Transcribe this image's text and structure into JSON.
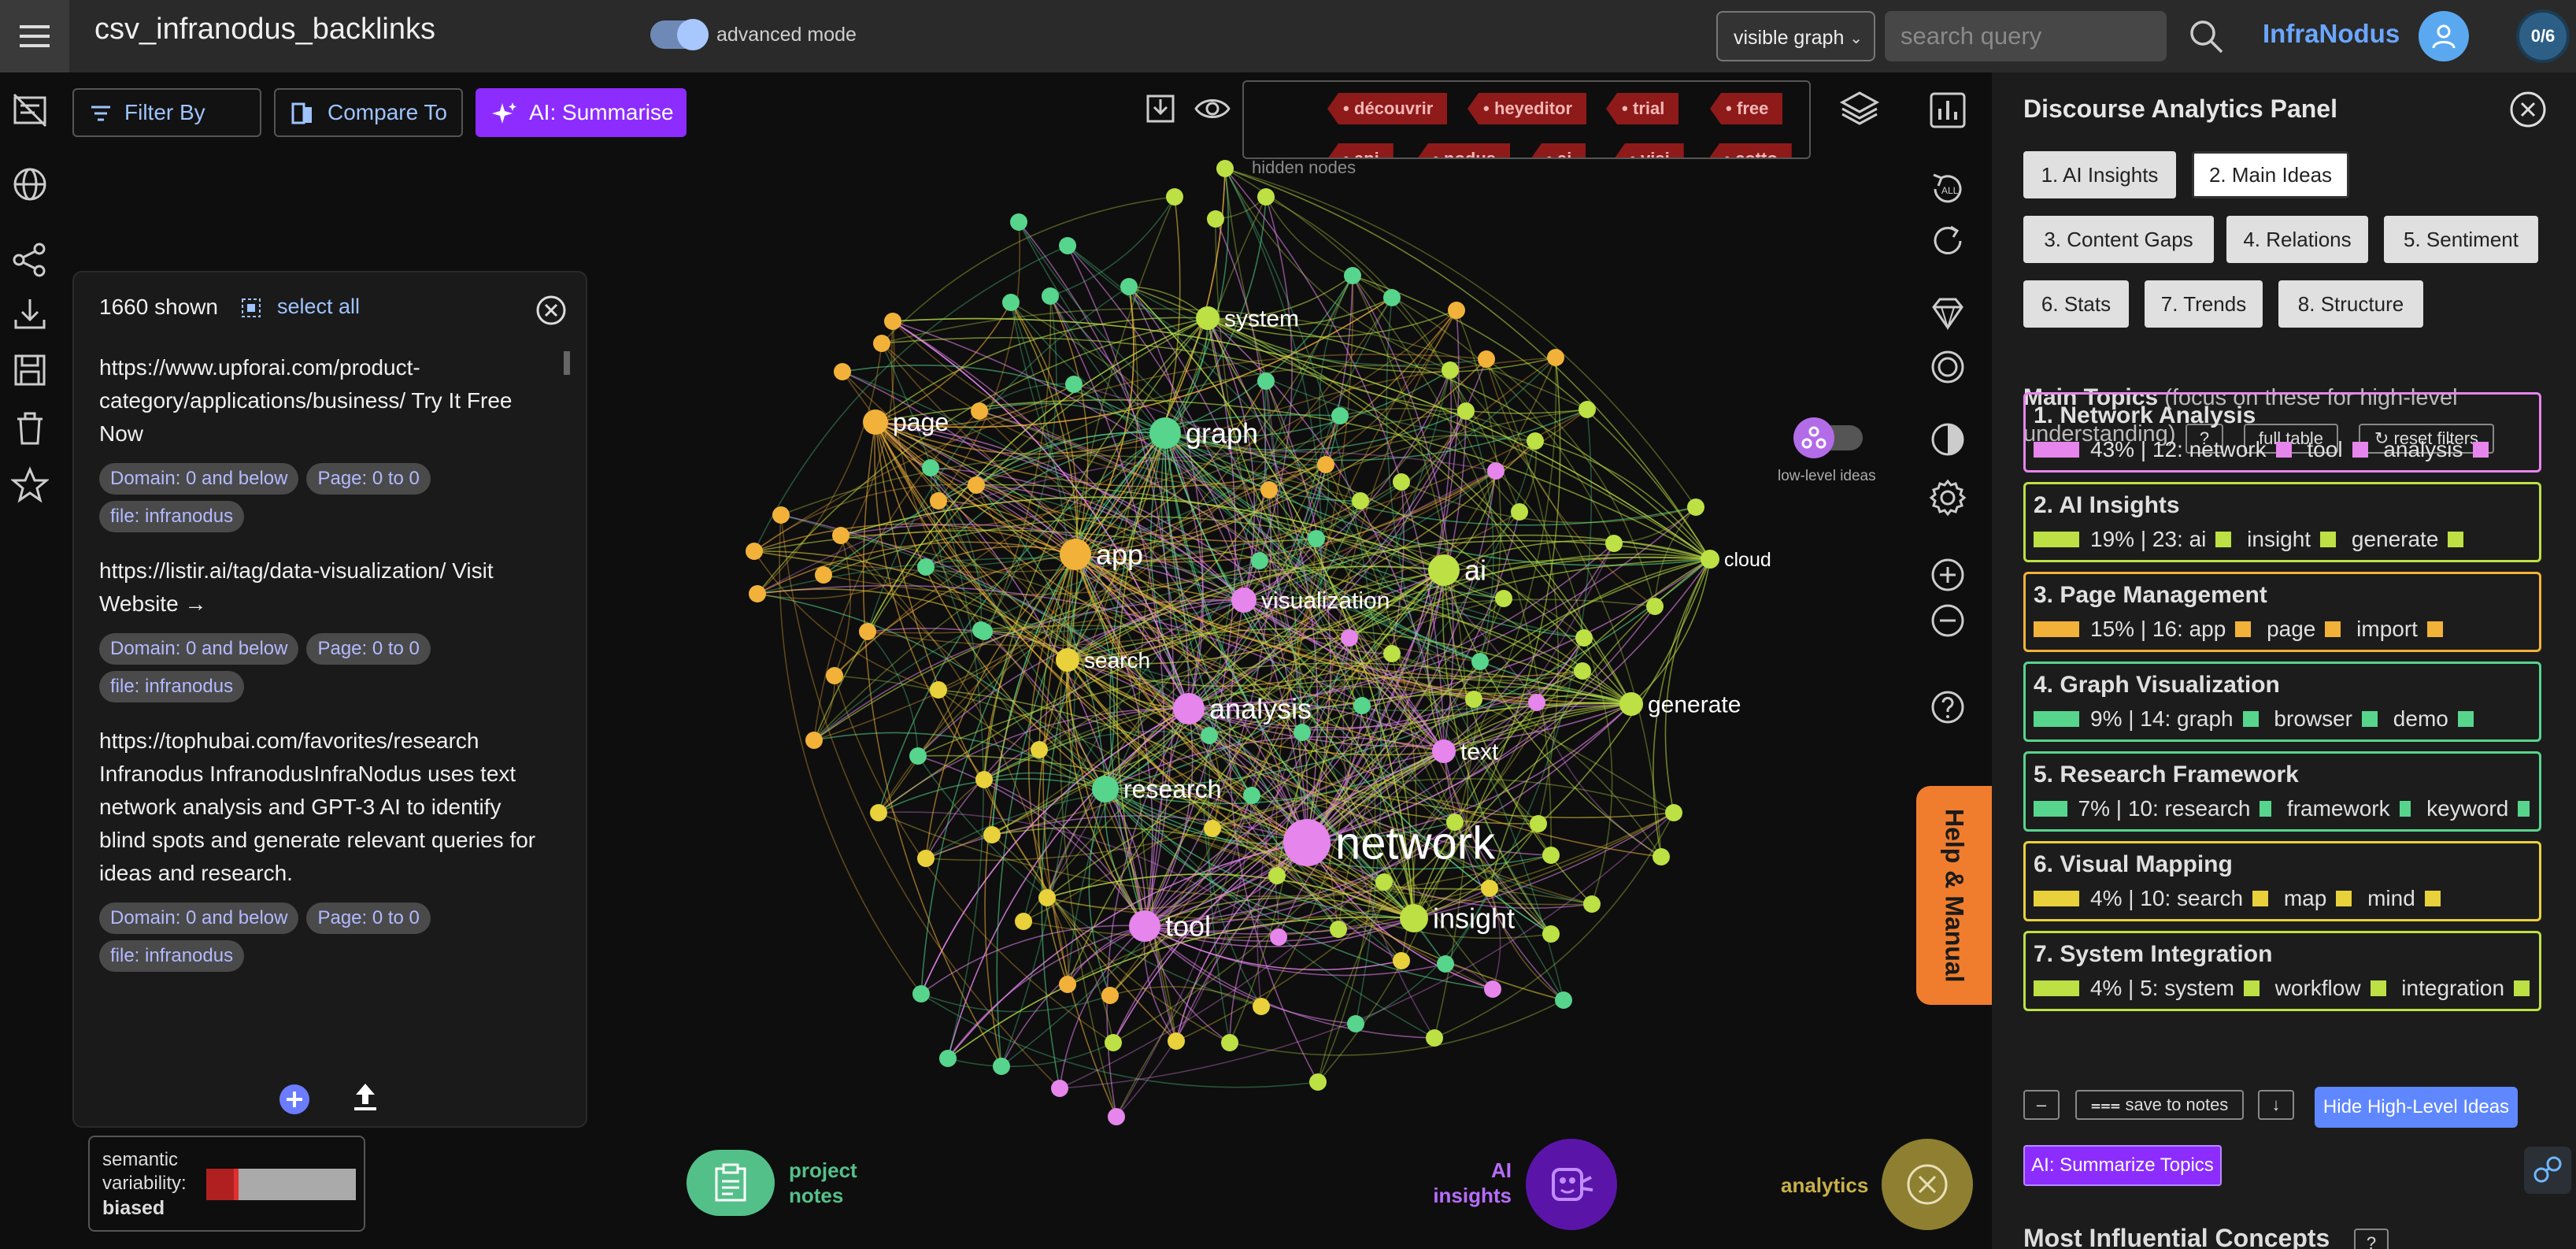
{
  "topbar": {
    "title": "csv_infranodus_backlinks",
    "advanced_label": "advanced mode",
    "visible_select": "visible graph",
    "search_placeholder": "search query",
    "brand": "InfraNodus",
    "counter": "0/6"
  },
  "toolbar": {
    "filter_label": "Filter By",
    "compare_label": "Compare To",
    "ai_summarise_label": "AI: Summarise",
    "hidden_nodes_label": "hidden nodes",
    "hidden_tags_row1": [
      "découvrir",
      "heyeditor",
      "trial",
      "free"
    ],
    "hidden_tags_row2": [
      "api",
      "nodus",
      "ai",
      "visi",
      "cotto"
    ]
  },
  "graph": {
    "labels": [
      "network",
      "analysis",
      "graph",
      "app",
      "tool",
      "research",
      "visualization",
      "ai",
      "insight",
      "text",
      "search",
      "system",
      "page",
      "generate",
      "cloud"
    ],
    "low_level_label": "low-level ideas",
    "colors": {
      "pink": "#e685ec",
      "green": "#57d58d",
      "orange": "#f2b23a",
      "lime": "#bde044",
      "yellow": "#e8d13a"
    }
  },
  "list_panel": {
    "shown": "1660 shown",
    "select_all": "select all",
    "entries": [
      {
        "url": "https://www.upforai.com/product-category/applications/business/ Try It Free Now",
        "chips": [
          "Domain: 0 and below",
          "Page: 0 to 0",
          "file: infranodus"
        ]
      },
      {
        "url": "https://listir.ai/tag/data-visualization/ Visit Website →",
        "chips": [
          "Domain: 0 and below",
          "Page: 0 to 0",
          "file: infranodus"
        ]
      },
      {
        "url": "https://tophubai.com/favorites/research Infranodus InfranodusInfraNodus uses text network analysis and GPT-3 AI to identify blind spots and generate relevant queries for ideas and research.",
        "chips": [
          "Domain: 0 and below",
          "Page: 0 to 0",
          "file: infranodus"
        ]
      }
    ]
  },
  "semantic": {
    "label": "semantic variability:",
    "value": "biased",
    "level": 0.2
  },
  "bottom": {
    "notes_label_1": "project",
    "notes_label_2": "notes",
    "insights_label_1": "AI",
    "insights_label_2": "insights",
    "analytics_label": "analytics"
  },
  "help_label": "Help & Manual",
  "panel": {
    "title": "Discourse Analytics Panel",
    "tabs": [
      "1. AI Insights",
      "2. Main Ideas",
      "3. Content Gaps",
      "4. Relations",
      "5. Sentiment",
      "6. Stats",
      "7. Trends",
      "8. Structure"
    ],
    "active_tab": "2. Main Ideas",
    "main_topics_title": "Main Topics",
    "main_topics_hint": "(focus on these for high-level understanding)",
    "question": "?",
    "full_table": "full table",
    "reset_filters": "↻ reset filters",
    "topics": [
      {
        "name": "1. Network Analysis",
        "stat": "43% | 12:",
        "words": [
          "network",
          "tool",
          "analysis"
        ],
        "color": "#e685ec"
      },
      {
        "name": "2. AI Insights",
        "stat": "19% | 23:",
        "words": [
          "ai",
          "insight",
          "generate"
        ],
        "color": "#bde044"
      },
      {
        "name": "3. Page Management",
        "stat": "15% | 16:",
        "words": [
          "app",
          "page",
          "import"
        ],
        "color": "#f2b23a"
      },
      {
        "name": "4. Graph Visualization",
        "stat": "9% | 14:",
        "words": [
          "graph",
          "browser",
          "demo"
        ],
        "color": "#57d58d"
      },
      {
        "name": "5. Research Framework",
        "stat": "7% | 10:",
        "words": [
          "research",
          "framework",
          "keyword"
        ],
        "color": "#57d58d"
      },
      {
        "name": "6. Visual Mapping",
        "stat": "4% | 10:",
        "words": [
          "search",
          "map",
          "mind"
        ],
        "color": "#e8d13a"
      },
      {
        "name": "7. System Integration",
        "stat": "4% | 5:",
        "words": [
          "system",
          "workflow",
          "integration"
        ],
        "color": "#bde044"
      }
    ],
    "minus": "–",
    "save_notes": "⩶ save to notes",
    "arrow": "↓",
    "hide_high_level": "Hide High-Level Ideas",
    "summarize_topics": "AI: Summarize Topics",
    "influential_title": "Most Influential Concepts"
  }
}
